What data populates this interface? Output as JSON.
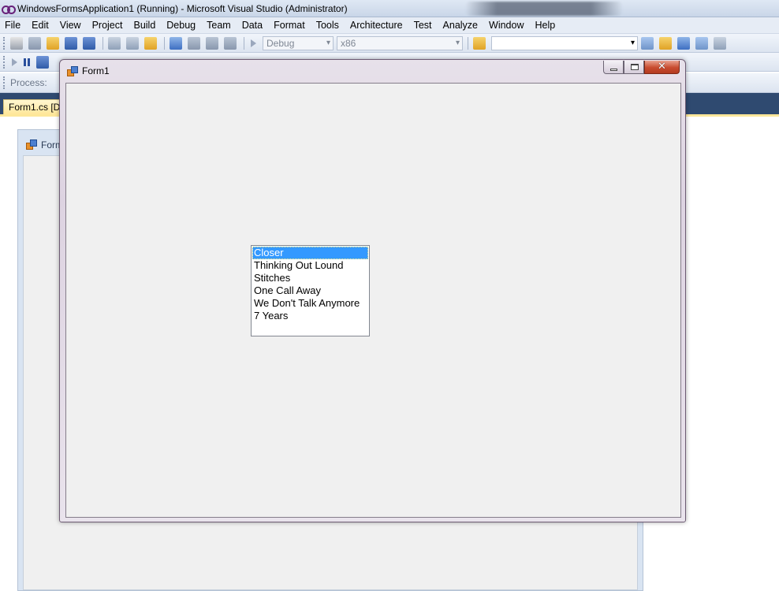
{
  "vs": {
    "title": "WindowsFormsApplication1 (Running) - Microsoft Visual Studio (Administrator)",
    "menu": [
      "File",
      "Edit",
      "View",
      "Project",
      "Build",
      "Debug",
      "Team",
      "Data",
      "Format",
      "Tools",
      "Architecture",
      "Test",
      "Analyze",
      "Window",
      "Help"
    ],
    "toolbar": {
      "config_value": "Debug",
      "platform_value": "x86",
      "find_value": ""
    },
    "process_label": "Process:",
    "doc_tab": "Form1.cs [De",
    "designer_form_title": "Form"
  },
  "form1": {
    "title": "Form1",
    "listbox": {
      "items": [
        "Closer",
        "Thinking Out Lound",
        "Stitches",
        "One Call Away",
        "We Don't Talk Anymore",
        "7 Years"
      ],
      "selected_index": 0
    }
  },
  "colors": {
    "selection": "#3399ff",
    "form_background": "#f0f0f0",
    "tabstrip": "#2f4a70",
    "close_button": "#c84b2f"
  }
}
